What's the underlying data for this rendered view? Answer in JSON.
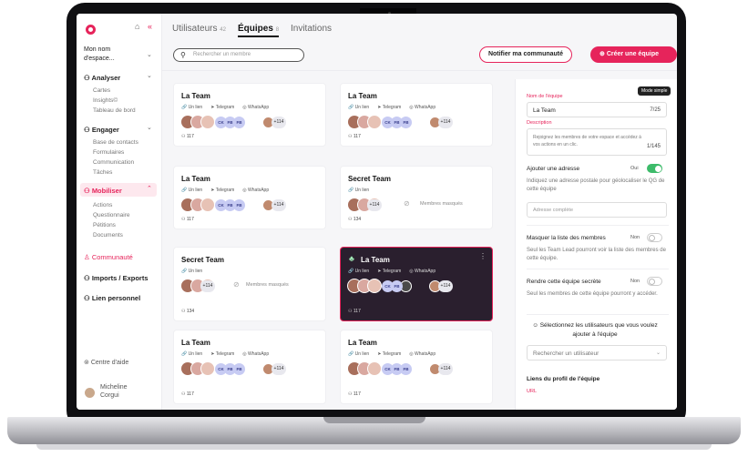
{
  "sidebar": {
    "space": "Mon nom d'espace...",
    "sections": [
      {
        "label": "Analyser",
        "items": [
          "Cartes",
          "Insights©",
          "Tableau de bord"
        ]
      },
      {
        "label": "Engager",
        "items": [
          "Base de contacts",
          "Formulaires",
          "Communication",
          "Tâches"
        ]
      },
      {
        "label": "Mobiliser",
        "items": [
          "Actions",
          "Questionnaire",
          "Pétitions",
          "Documents"
        ]
      }
    ],
    "communaute": "Communauté",
    "imports": "Imports / Exports",
    "lien": "Lien personnel",
    "help": "Centre d'aide",
    "user": "Micheline Corgui"
  },
  "tabs": [
    {
      "label": "Utilisateurs",
      "count": "42"
    },
    {
      "label": "Équipes",
      "count": "8"
    },
    {
      "label": "Invitations",
      "count": ""
    }
  ],
  "search": {
    "placeholder": "Rechercher un membre"
  },
  "buttons": {
    "notify": "Notifier ma communauté",
    "create": "Créer une équipe"
  },
  "cards": [
    {
      "title": "La Team",
      "links": [
        "Un lien",
        "Telegram",
        "WhatsApp"
      ],
      "pills": [
        "CK",
        "FB",
        "FB"
      ],
      "more": "+114",
      "count": "117",
      "masked": false
    },
    {
      "title": "La Team",
      "links": [
        "Un lien",
        "Telegram",
        "WhatsApp"
      ],
      "pills": [
        "CK",
        "FB",
        "FB"
      ],
      "more": "+114",
      "count": "117",
      "masked": false
    },
    {
      "title": "La Team",
      "links": [
        "Un lien",
        "Telegram",
        "WhatsApp"
      ],
      "pills": [
        "CK",
        "FB",
        "FB"
      ],
      "more": "+114",
      "count": "117",
      "masked": false
    },
    {
      "title": "Secret Team",
      "links": [
        "Un lien"
      ],
      "pills": [],
      "more": "+114",
      "count": "134",
      "masked": true
    },
    {
      "title": "Secret Team",
      "links": [
        "Un lien"
      ],
      "pills": [],
      "more": "+114",
      "count": "134",
      "masked": true
    },
    {
      "title": "La Team",
      "links": [
        "Un lien",
        "Telegram",
        "WhatsApp"
      ],
      "pills": [
        "CK",
        "FB"
      ],
      "more": "+114",
      "count": "117",
      "masked": false
    },
    {
      "title": "La Team",
      "links": [
        "Un lien",
        "Telegram",
        "WhatsApp"
      ],
      "pills": [
        "CK",
        "FB",
        "FB"
      ],
      "more": "+114",
      "count": "117",
      "masked": false
    },
    {
      "title": "La Team",
      "links": [
        "Un lien",
        "Telegram",
        "WhatsApp"
      ],
      "pills": [
        "CK",
        "FB",
        "FB"
      ],
      "more": "+114",
      "count": "117",
      "masked": false
    }
  ],
  "masked_label": "Membres masqués",
  "panel": {
    "mode": "Mode simple",
    "name_label": "Nom de l'équipe",
    "name_value": "La Team",
    "name_count": "7/25",
    "desc_label": "Description",
    "desc_value": "Rejoignez les membres de votre espace et accédez à vos actions en un clic.",
    "desc_count": "1/145",
    "address_title": "Ajouter une adresse",
    "address_toggle": "Oui",
    "address_desc": "Indiquez une adresse postale pour géolocaliser le QG de cette équipe",
    "address_placeholder": "Adresse complète",
    "hide_title": "Masquer la liste des membres",
    "hide_toggle": "Non",
    "hide_desc": "Seul les Team Lead pourront voir la liste des membres de cette équipe.",
    "secret_title": "Rendre cette équipe secrète",
    "secret_toggle": "Non",
    "secret_desc": "Seul les membres de cette équipe pourront y accéder.",
    "users_title": "Sélectionnez les utilisateurs que vous voulez ajouter à l'équipe",
    "users_placeholder": "Rechercher un utilisateur",
    "links_title": "Liens du profil de l'équipe",
    "url_label": "URL"
  },
  "colors": {
    "accent": "#e6245b",
    "toggle_on": "#3dbb6a",
    "pill": "#c7cbf3",
    "dark_card": "#2a1f2e"
  }
}
